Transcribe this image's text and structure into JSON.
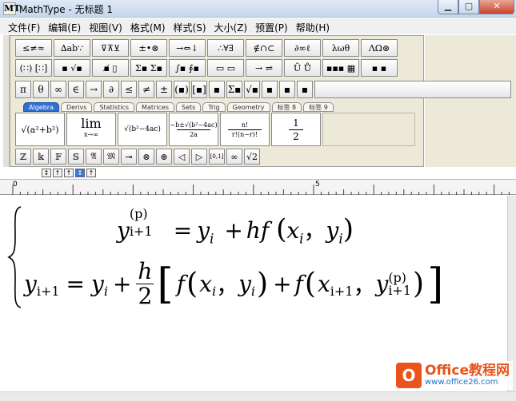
{
  "window": {
    "title": "MathType - 无标题 1",
    "app_icon": "MT"
  },
  "menu": [
    "文件(F)",
    "编辑(E)",
    "视图(V)",
    "格式(M)",
    "样式(S)",
    "大小(Z)",
    "预置(P)",
    "帮助(H)"
  ],
  "toolbar": {
    "row1": [
      "≤≠≈",
      "∆ab∵",
      "⊽⊼⊻",
      "±•⊗",
      "→⇔↓",
      "∴∀∃",
      "∉∩⊂",
      "∂∞ℓ",
      "λωθ",
      "ΛΩ⊛"
    ],
    "row2": [
      "(∷) [∷]",
      "▪ √▪",
      "▪̸ ▯",
      "Σ▪ Σ▪",
      "∫▪ ∮▪",
      "▭ ▭",
      "→ ⇌",
      "Ū Ů",
      "▪▪▪ ▦",
      "▪ ▪"
    ],
    "row3": [
      "π",
      "θ",
      "∞",
      "∈",
      "→",
      "∂",
      "≤",
      "≠",
      "±",
      "(▪)",
      "[▪]",
      "▪",
      "Σ▪",
      "√▪",
      "▪",
      "▪",
      "▪"
    ],
    "tabs": [
      "Algebra",
      "Derivs",
      "Statistics",
      "Matrices",
      "Sets",
      "Trig",
      "Geometry",
      "标签 8",
      "标签 9"
    ],
    "active_tab": "Algebra",
    "templates": {
      "t1": "√(a²+b²)",
      "t2_top": "lim",
      "t2_bottom": "x→∞",
      "t3": "√(b²−4ac)",
      "t4_top": "−b±√(b²−4ac)",
      "t4_bottom": "2a",
      "t5_top": "n!",
      "t5_bottom": "r!(n−r)!",
      "t6_top": "1",
      "t6_bottom": "2"
    },
    "row5": [
      "ℤ",
      "𝕜",
      "𝔽",
      "𝕊",
      "𝔄",
      "𝔐",
      "⊸",
      "⊗",
      "⊕",
      "◁",
      "▷",
      "[0,1]",
      "∞",
      "√2"
    ],
    "nudge": [
      "↕",
      "↑",
      "↑",
      "↕",
      "↑"
    ]
  },
  "ruler": {
    "label_0": "0",
    "label_5": "5"
  },
  "equation": {
    "line1": {
      "y": "y",
      "sub": "i+1",
      "sup": "(p)",
      "eq": "=",
      "yi": "y",
      "yi_sub": "i",
      "plus": "+",
      "hf": "hf",
      "args": "x",
      "x_sub": "i",
      "comma": "，",
      "y2": "y",
      "y2_sub": "i"
    },
    "line2": {
      "y": "y",
      "sub": "i+1",
      "eq": "=",
      "yi": "y",
      "yi_sub": "i",
      "plus": "+",
      "frac_num": "h",
      "frac_den": "2",
      "f1": "f",
      "x1": "x",
      "x1_sub": "i",
      "comma1": "，",
      "y1": "y",
      "y1_sub": "i",
      "plus2": "+",
      "f2": "f",
      "x2": "x",
      "x2_sub": "i+1",
      "comma2": "，",
      "y3": "y",
      "y3_sub": "i+1",
      "y3_sup": "(p)"
    }
  },
  "watermark": {
    "logo": "O",
    "line1": "Office教程网",
    "line2": "www.office26.com"
  }
}
